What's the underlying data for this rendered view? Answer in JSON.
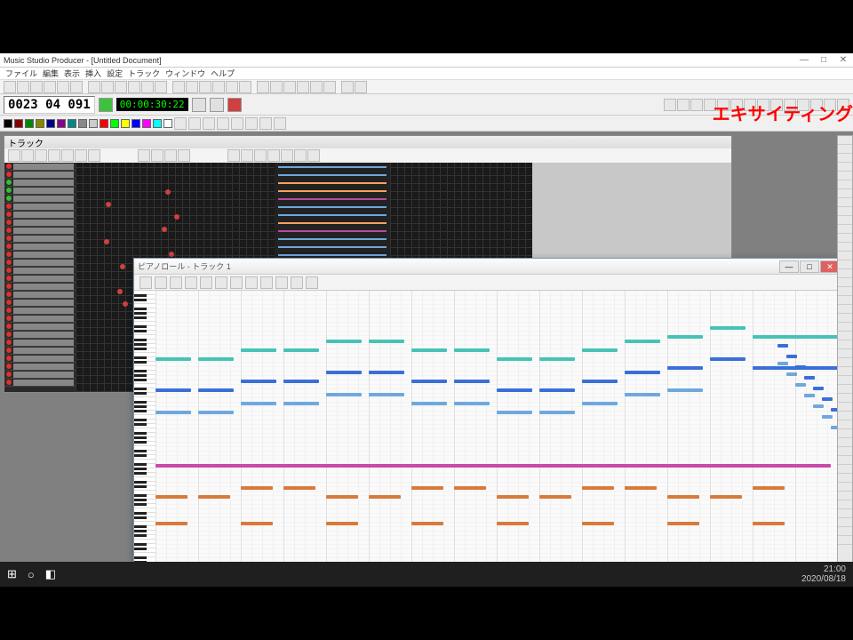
{
  "app": {
    "title": "Music Studio Producer - [Untitled Document]",
    "menubar": [
      "ファイル",
      "編集",
      "表示",
      "挿入",
      "設定",
      "トラック",
      "ウィンドウ",
      "ヘルプ"
    ]
  },
  "transport": {
    "counter": "0023 04 091",
    "timecode": "00:00:30:22",
    "play_label": "▶",
    "stop_label": "■",
    "rec_label": "●"
  },
  "overlay": {
    "text": "エキサイティング"
  },
  "track_window": {
    "title": "トラック",
    "track_count": 28,
    "led_colors": [
      "#e03030",
      "#e03030",
      "#30c030",
      "#30c030",
      "#30c030",
      "#e03030",
      "#e03030",
      "#e03030",
      "#e03030",
      "#e03030",
      "#e03030",
      "#e03030",
      "#e03030",
      "#e03030",
      "#e03030",
      "#e03030",
      "#e03030",
      "#e03030",
      "#e03030",
      "#e03030",
      "#e03030",
      "#e03030",
      "#e03030",
      "#e03030",
      "#e03030",
      "#e03030",
      "#e03030",
      "#e03030"
    ],
    "event_colors": [
      "#6fa8dc",
      "#6fa8dc",
      "#ffa060",
      "#ffa060",
      "#b84aa0",
      "#6fa8dc",
      "#6fa8dc",
      "#ffa060",
      "#b84aa0",
      "#6fa8dc",
      "#6fa8dc",
      "#6fa8dc",
      "#6fa8dc",
      "#6fa8dc",
      "#6fa8dc",
      "#6fa8dc",
      "#6fa8dc",
      "#6fa8dc",
      "#6fa8dc",
      "#6fa8dc",
      "#6fa8dc",
      "#6fa8dc",
      "#6fa8dc",
      "#6fa8dc",
      "#6fa8dc",
      "#6fa8dc",
      "#6fa8dc",
      "#6fa8dc"
    ]
  },
  "piano_window": {
    "title": "ピアノロール - トラック 1",
    "min_btn": "—",
    "max_btn": "□",
    "close_btn": "✕",
    "notes": [
      {
        "t": 0,
        "p": 60,
        "l": 40,
        "c": "#3a6fd8"
      },
      {
        "t": 48,
        "p": 60,
        "l": 40,
        "c": "#3a6fd8"
      },
      {
        "t": 96,
        "p": 62,
        "l": 40,
        "c": "#3a6fd8"
      },
      {
        "t": 144,
        "p": 62,
        "l": 40,
        "c": "#3a6fd8"
      },
      {
        "t": 192,
        "p": 64,
        "l": 40,
        "c": "#3a6fd8"
      },
      {
        "t": 240,
        "p": 64,
        "l": 40,
        "c": "#3a6fd8"
      },
      {
        "t": 288,
        "p": 62,
        "l": 40,
        "c": "#3a6fd8"
      },
      {
        "t": 336,
        "p": 62,
        "l": 40,
        "c": "#3a6fd8"
      },
      {
        "t": 384,
        "p": 60,
        "l": 40,
        "c": "#3a6fd8"
      },
      {
        "t": 432,
        "p": 60,
        "l": 40,
        "c": "#3a6fd8"
      },
      {
        "t": 480,
        "p": 62,
        "l": 40,
        "c": "#3a6fd8"
      },
      {
        "t": 528,
        "p": 64,
        "l": 40,
        "c": "#3a6fd8"
      },
      {
        "t": 576,
        "p": 65,
        "l": 40,
        "c": "#3a6fd8"
      },
      {
        "t": 624,
        "p": 67,
        "l": 40,
        "c": "#3a6fd8"
      },
      {
        "t": 672,
        "p": 65,
        "l": 100,
        "c": "#3a6fd8"
      },
      {
        "t": 0,
        "p": 67,
        "l": 40,
        "c": "#46c3b4"
      },
      {
        "t": 48,
        "p": 67,
        "l": 40,
        "c": "#46c3b4"
      },
      {
        "t": 96,
        "p": 69,
        "l": 40,
        "c": "#46c3b4"
      },
      {
        "t": 144,
        "p": 69,
        "l": 40,
        "c": "#46c3b4"
      },
      {
        "t": 192,
        "p": 71,
        "l": 40,
        "c": "#46c3b4"
      },
      {
        "t": 240,
        "p": 71,
        "l": 40,
        "c": "#46c3b4"
      },
      {
        "t": 288,
        "p": 69,
        "l": 40,
        "c": "#46c3b4"
      },
      {
        "t": 336,
        "p": 69,
        "l": 40,
        "c": "#46c3b4"
      },
      {
        "t": 384,
        "p": 67,
        "l": 40,
        "c": "#46c3b4"
      },
      {
        "t": 432,
        "p": 67,
        "l": 40,
        "c": "#46c3b4"
      },
      {
        "t": 480,
        "p": 69,
        "l": 40,
        "c": "#46c3b4"
      },
      {
        "t": 528,
        "p": 71,
        "l": 40,
        "c": "#46c3b4"
      },
      {
        "t": 576,
        "p": 72,
        "l": 40,
        "c": "#46c3b4"
      },
      {
        "t": 624,
        "p": 74,
        "l": 40,
        "c": "#46c3b4"
      },
      {
        "t": 672,
        "p": 72,
        "l": 100,
        "c": "#46c3b4"
      },
      {
        "t": 0,
        "p": 55,
        "l": 40,
        "c": "#6fa8dc"
      },
      {
        "t": 48,
        "p": 55,
        "l": 40,
        "c": "#6fa8dc"
      },
      {
        "t": 96,
        "p": 57,
        "l": 40,
        "c": "#6fa8dc"
      },
      {
        "t": 144,
        "p": 57,
        "l": 40,
        "c": "#6fa8dc"
      },
      {
        "t": 192,
        "p": 59,
        "l": 40,
        "c": "#6fa8dc"
      },
      {
        "t": 240,
        "p": 59,
        "l": 40,
        "c": "#6fa8dc"
      },
      {
        "t": 288,
        "p": 57,
        "l": 40,
        "c": "#6fa8dc"
      },
      {
        "t": 336,
        "p": 57,
        "l": 40,
        "c": "#6fa8dc"
      },
      {
        "t": 384,
        "p": 55,
        "l": 40,
        "c": "#6fa8dc"
      },
      {
        "t": 432,
        "p": 55,
        "l": 40,
        "c": "#6fa8dc"
      },
      {
        "t": 480,
        "p": 57,
        "l": 40,
        "c": "#6fa8dc"
      },
      {
        "t": 528,
        "p": 59,
        "l": 40,
        "c": "#6fa8dc"
      },
      {
        "t": 576,
        "p": 60,
        "l": 40,
        "c": "#6fa8dc"
      },
      {
        "t": 0,
        "p": 36,
        "l": 36,
        "c": "#d87a3a"
      },
      {
        "t": 48,
        "p": 36,
        "l": 36,
        "c": "#d87a3a"
      },
      {
        "t": 96,
        "p": 38,
        "l": 36,
        "c": "#d87a3a"
      },
      {
        "t": 144,
        "p": 38,
        "l": 36,
        "c": "#d87a3a"
      },
      {
        "t": 192,
        "p": 36,
        "l": 36,
        "c": "#d87a3a"
      },
      {
        "t": 240,
        "p": 36,
        "l": 36,
        "c": "#d87a3a"
      },
      {
        "t": 288,
        "p": 38,
        "l": 36,
        "c": "#d87a3a"
      },
      {
        "t": 336,
        "p": 38,
        "l": 36,
        "c": "#d87a3a"
      },
      {
        "t": 384,
        "p": 36,
        "l": 36,
        "c": "#d87a3a"
      },
      {
        "t": 432,
        "p": 36,
        "l": 36,
        "c": "#d87a3a"
      },
      {
        "t": 480,
        "p": 38,
        "l": 36,
        "c": "#d87a3a"
      },
      {
        "t": 528,
        "p": 38,
        "l": 36,
        "c": "#d87a3a"
      },
      {
        "t": 576,
        "p": 36,
        "l": 36,
        "c": "#d87a3a"
      },
      {
        "t": 624,
        "p": 36,
        "l": 36,
        "c": "#d87a3a"
      },
      {
        "t": 672,
        "p": 38,
        "l": 36,
        "c": "#d87a3a"
      },
      {
        "t": 0,
        "p": 43,
        "l": 760,
        "c": "#c84aa8"
      },
      {
        "t": 0,
        "p": 30,
        "l": 36,
        "c": "#d87a3a"
      },
      {
        "t": 96,
        "p": 30,
        "l": 36,
        "c": "#d87a3a"
      },
      {
        "t": 192,
        "p": 30,
        "l": 36,
        "c": "#d87a3a"
      },
      {
        "t": 288,
        "p": 30,
        "l": 36,
        "c": "#d87a3a"
      },
      {
        "t": 384,
        "p": 30,
        "l": 36,
        "c": "#d87a3a"
      },
      {
        "t": 480,
        "p": 30,
        "l": 36,
        "c": "#d87a3a"
      },
      {
        "t": 576,
        "p": 30,
        "l": 36,
        "c": "#d87a3a"
      },
      {
        "t": 672,
        "p": 30,
        "l": 36,
        "c": "#d87a3a"
      }
    ]
  },
  "taskbar": {
    "start": "⊞",
    "search": "○",
    "cortana": "◧",
    "clock": "21:00",
    "date": "2020/08/18"
  },
  "colors": {
    "swatches": [
      "#000",
      "#800",
      "#080",
      "#880",
      "#008",
      "#808",
      "#088",
      "#888",
      "#ccc",
      "#f00",
      "#0f0",
      "#ff0",
      "#00f",
      "#f0f",
      "#0ff",
      "#fff"
    ]
  }
}
